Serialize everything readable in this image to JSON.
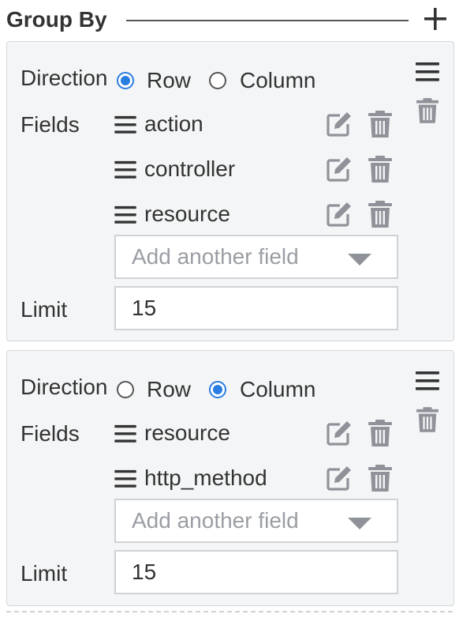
{
  "header": {
    "title": "Group By"
  },
  "groups": [
    {
      "direction_label": "Direction",
      "row_label": "Row",
      "column_label": "Column",
      "selected_direction": "Row",
      "fields_label": "Fields",
      "fields": [
        "action",
        "controller",
        "resource"
      ],
      "add_field_placeholder": "Add another field",
      "limit_label": "Limit",
      "limit_value": "15"
    },
    {
      "direction_label": "Direction",
      "row_label": "Row",
      "column_label": "Column",
      "selected_direction": "Column",
      "fields_label": "Fields",
      "fields": [
        "resource",
        "http_method"
      ],
      "add_field_placeholder": "Add another field",
      "limit_label": "Limit",
      "limit_value": "15"
    }
  ],
  "colors": {
    "accent": "#2a7de1",
    "icon_gray": "#8f9399",
    "panel_bg": "#f4f5f6"
  },
  "icons": [
    "plus-icon",
    "hamburger-menu-icon",
    "trash-icon",
    "drag-handle-icon",
    "edit-icon",
    "chevron-down-icon"
  ]
}
